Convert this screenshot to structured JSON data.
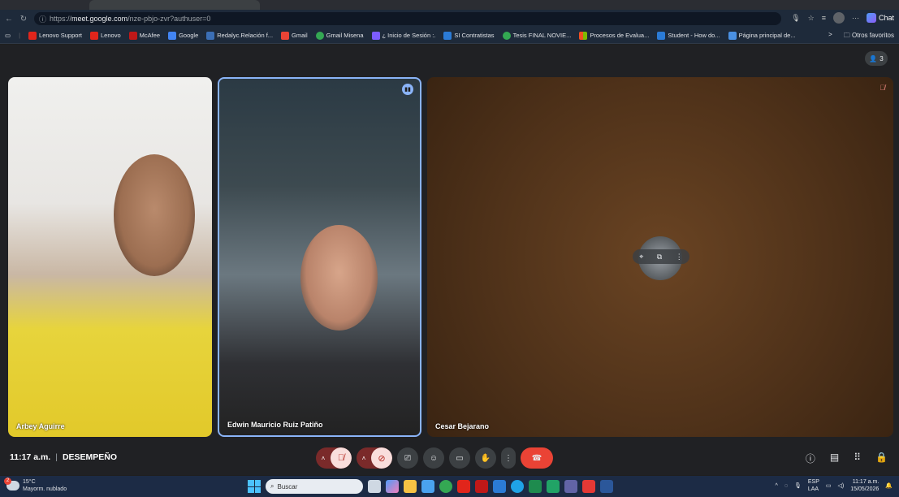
{
  "browser": {
    "url_prefix": "https://",
    "url_host": "meet.google.com",
    "url_path": "/nze-pbjo-zvr?authuser=0",
    "chat_label": "Chat",
    "more": "···"
  },
  "bookmarks": {
    "items": [
      {
        "label": "Lenovo Support",
        "color": "#e1251b"
      },
      {
        "label": "Lenovo",
        "color": "#e1251b"
      },
      {
        "label": "McAfee",
        "color": "#c01818"
      },
      {
        "label": "Google",
        "color": "#4285f4"
      },
      {
        "label": "Redalyc.Relación f...",
        "color": "#3b6fb6"
      },
      {
        "label": "Gmail",
        "color": "#ea4335"
      },
      {
        "label": "Gmail Misena",
        "color": "#34a853"
      },
      {
        "label": "¿ Inicio de Sesión :.",
        "color": "#7c5cff"
      },
      {
        "label": "SI Contratistas",
        "color": "#2b7bd6"
      },
      {
        "label": "Tesis FINAL NOVIE...",
        "color": "#33a852"
      },
      {
        "label": "Procesos de Evalua...",
        "color": "#f25022"
      },
      {
        "label": "Student - How do...",
        "color": "#2b7bd6"
      },
      {
        "label": "Página principal de...",
        "color": "#4a90e2"
      }
    ],
    "more": ">",
    "other": "Otros favoritos"
  },
  "meet": {
    "people_count": "3",
    "tiles": [
      {
        "name": "Arbey Aguirre"
      },
      {
        "name": "Edwin Mauricio Ruiz Patiño"
      },
      {
        "name": "Cesar Bejarano"
      }
    ],
    "time": "11:17 a.m.",
    "separator": "|",
    "meeting_name": "DESEMPEÑO"
  },
  "taskbar": {
    "weather_badge": "2",
    "temp": "15°C",
    "weather": "Mayorm. nublado",
    "search_placeholder": "Buscar",
    "lang1": "ESP",
    "lang2": "LAA",
    "time": "11:17 a.m.",
    "date": "15/05/2026"
  }
}
